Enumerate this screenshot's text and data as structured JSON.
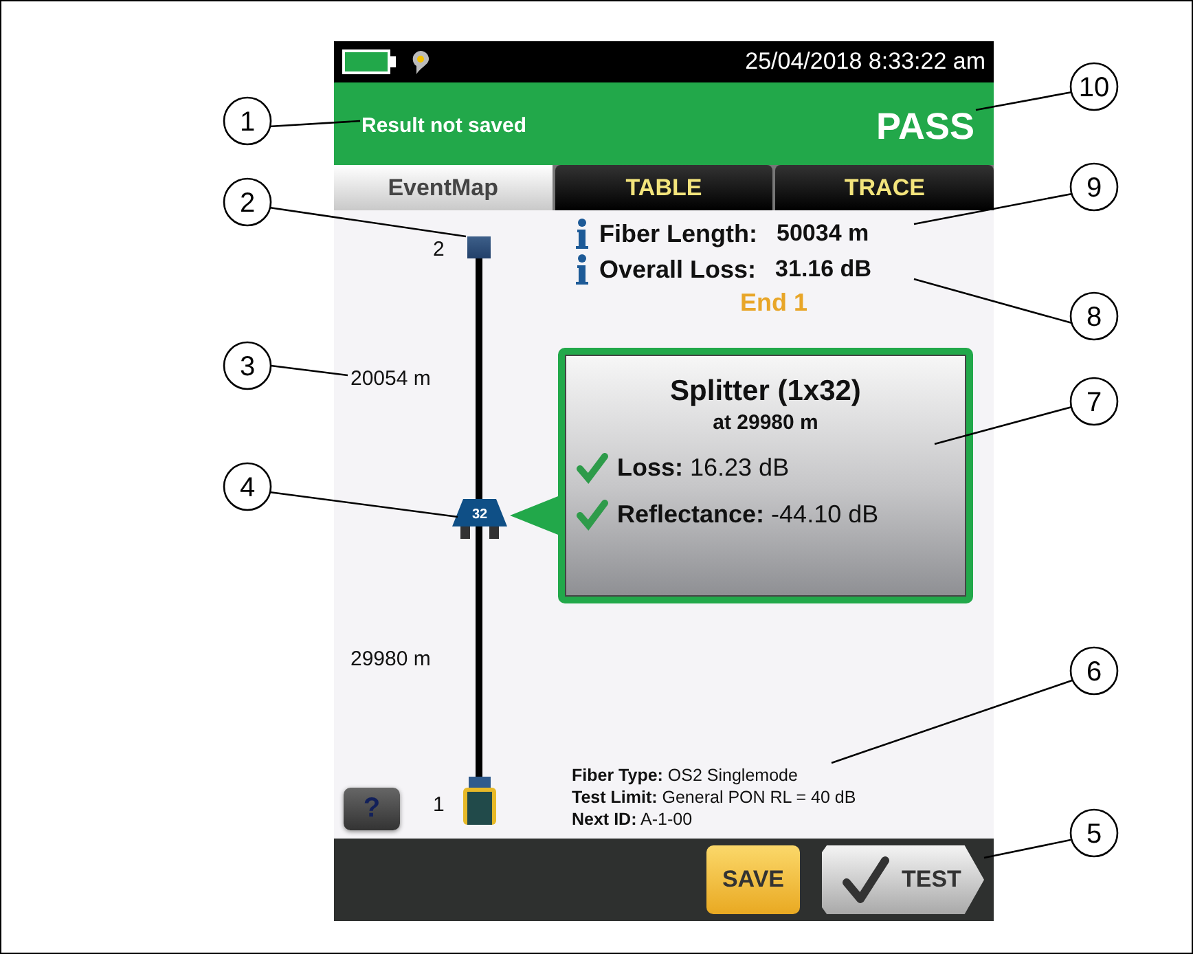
{
  "status_bar": {
    "date_time": "25/04/2018 8:33:22 am"
  },
  "header": {
    "message": "Result not saved",
    "result": "PASS"
  },
  "tabs": [
    {
      "label": "EventMap",
      "selected": true
    },
    {
      "label": "TABLE",
      "selected": false
    },
    {
      "label": "TRACE",
      "selected": false
    }
  ],
  "event_map": {
    "far_end": "2",
    "near_end": "1",
    "splitter": "32",
    "distances": [
      "20054 m",
      "29980 m"
    ]
  },
  "summary": [
    {
      "label": "Fiber Length:",
      "value": "50034 m"
    },
    {
      "label": "Overall Loss:",
      "value": "31.16 dB"
    }
  ],
  "end": "End 1",
  "event": {
    "title": "Splitter (1x32)",
    "location": "at 29980 m",
    "results": [
      {
        "text": "**Loss:** 16.23 dB",
        "passed": true
      },
      {
        "text": "**Reflectance:** -44.10 dB",
        "passed": true
      }
    ]
  },
  "details": [
    "**Fiber Type:** OS2 Singlemode",
    "**Test Limit:** General PON RL = 40 dB",
    "**Next ID:** A-1-00"
  ],
  "help_button": "?",
  "buttons": {
    "save": "SAVE",
    "test": "TEST"
  },
  "callouts": [
    "1",
    "2",
    "3",
    "4",
    "10",
    "9",
    "8",
    "7",
    "6",
    "5"
  ]
}
